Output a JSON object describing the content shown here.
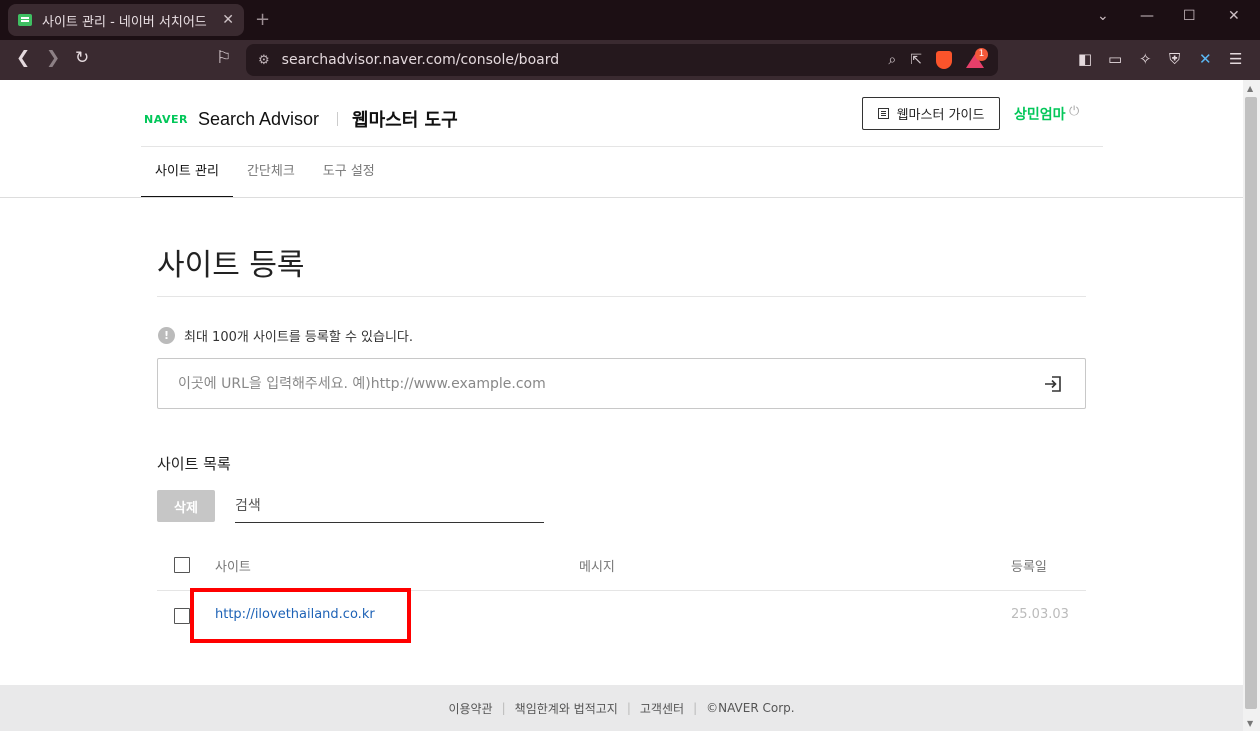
{
  "browser": {
    "tab_title": "사이트 관리 - 네이버 서치어드",
    "tab_close": "✕",
    "new_tab": "+",
    "url": "searchadvisor.naver.com/console/board",
    "badge_count": "1"
  },
  "header": {
    "naver_logo": "NAVER",
    "product": "Search Advisor",
    "tool_title": "웹마스터 도구",
    "guide_button": "웹마스터 가이드",
    "user_name": "상민엄마"
  },
  "nav": {
    "tabs": [
      {
        "label": "사이트 관리",
        "active": true
      },
      {
        "label": "간단체크",
        "active": false
      },
      {
        "label": "도구 설정",
        "active": false
      }
    ]
  },
  "register": {
    "title": "사이트 등록",
    "notice": "최대 100개 사이트를 등록할 수 있습니다.",
    "url_placeholder": "이곳에 URL을 입력해주세요. 예)http://www.example.com"
  },
  "site_list": {
    "title": "사이트 목록",
    "delete_button": "삭제",
    "search_placeholder": "검색",
    "columns": {
      "site": "사이트",
      "message": "메시지",
      "date": "등록일"
    },
    "rows": [
      {
        "site": "http://ilovethailand.co.kr",
        "message": "",
        "date": "25.03.03"
      }
    ]
  },
  "footer": {
    "links": [
      "이용약관",
      "책임한계와 법적고지",
      "고객센터"
    ],
    "copyright": "©NAVER Corp."
  },
  "colors": {
    "naver_green": "#03c75a",
    "link_blue": "#1d62b6",
    "highlight_red": "#ff0000"
  }
}
